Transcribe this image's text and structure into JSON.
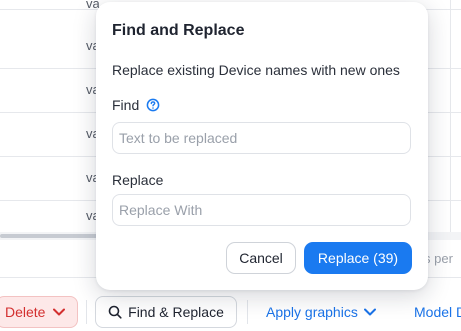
{
  "table": {
    "rows": [
      {
        "cell": "va"
      },
      {
        "cell": "va"
      },
      {
        "cell": "va"
      },
      {
        "cell": "va"
      },
      {
        "cell": "va"
      },
      {
        "cell": "va"
      }
    ],
    "right_header_fragment": "",
    "pager_text": "s per"
  },
  "toolbar": {
    "delete_label": "Delete",
    "find_replace_label": "Find & Replace",
    "apply_graphics_label": "Apply graphics",
    "model_label": "Model D"
  },
  "dialog": {
    "title": "Find and Replace",
    "description": "Replace existing Device names with new ones",
    "find_label": "Find",
    "find_placeholder": "Text to be replaced",
    "find_value": "",
    "replace_label": "Replace",
    "replace_placeholder": "Replace With",
    "replace_value": "",
    "cancel_label": "Cancel",
    "replace_button_label": "Replace (39)"
  },
  "colors": {
    "accent": "#1a7af0",
    "danger": "#d32f2f",
    "danger_bg": "#fde8e8"
  },
  "icons": {
    "help": "question-circle-icon",
    "search": "search-icon",
    "chevron": "chevron-down-icon"
  }
}
